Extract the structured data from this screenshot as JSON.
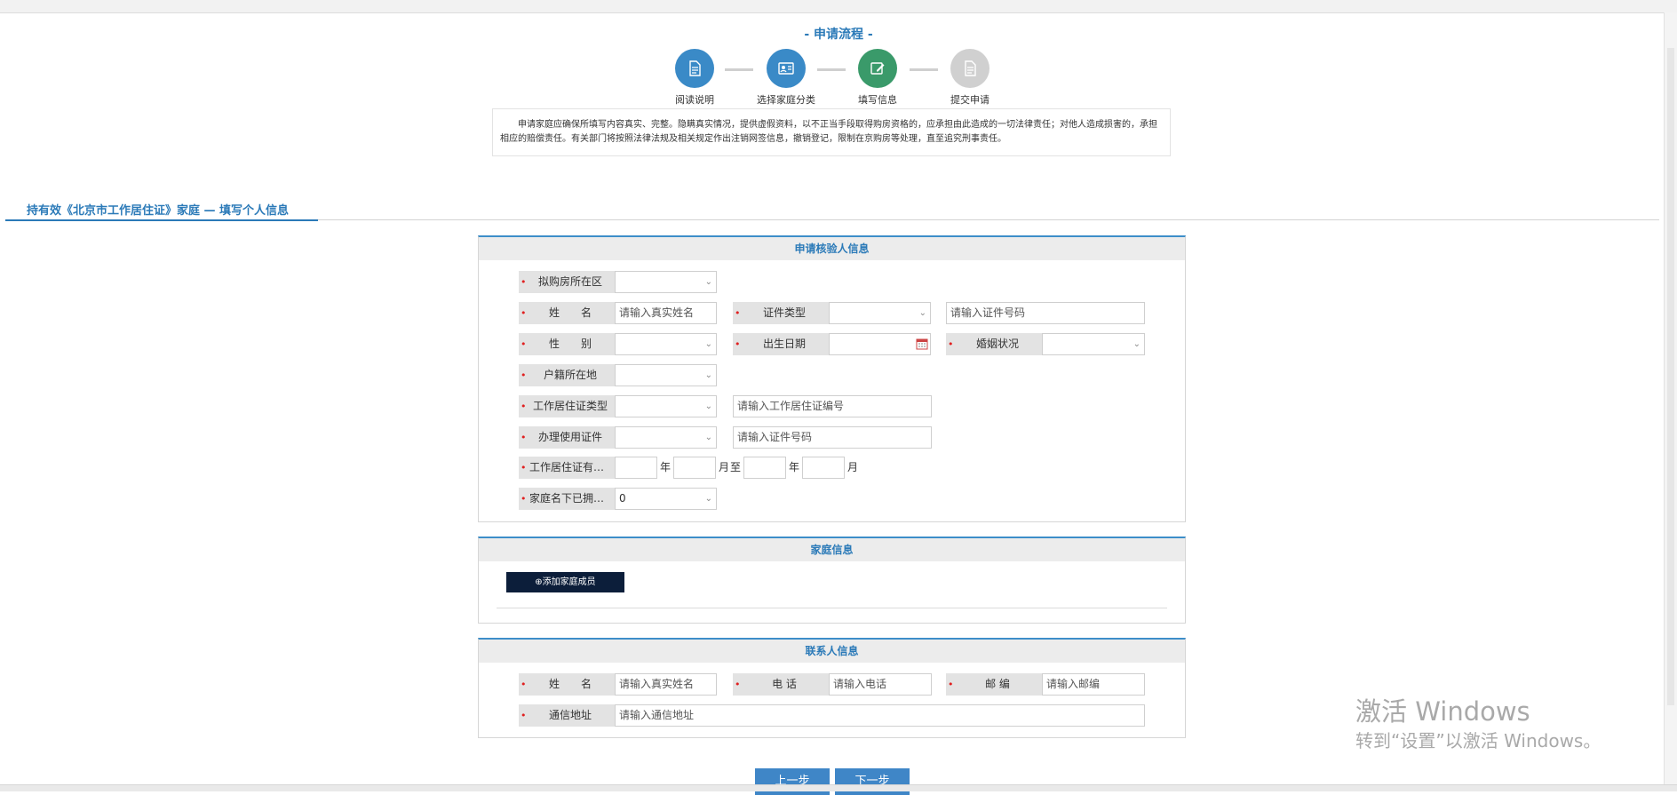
{
  "flow": {
    "title": "- 申请流程 -",
    "steps": [
      {
        "label": "阅读说明",
        "icon": "document-icon",
        "color": "#3a8ac7"
      },
      {
        "label": "选择家庭分类",
        "icon": "id-card-icon",
        "color": "#3a8ac7"
      },
      {
        "label": "填写信息",
        "icon": "edit-icon",
        "color": "#3a9a6a"
      },
      {
        "label": "提交申请",
        "icon": "document-icon",
        "color": "#d0d0d0"
      }
    ],
    "notice": "申请家庭应确保所填写内容真实、完整。隐瞒真实情况，提供虚假资料，以不正当手段取得购房资格的，应承担由此造成的一切法律责任；对他人造成损害的，承担相应的赔偿责任。有关部门将按照法律法规及相关规定作出注销网签信息，撤销登记，限制在京购房等处理，直至追究刑事责任。"
  },
  "page_title": "持有效《北京市工作居住证》家庭 — 填写个人信息",
  "applicant": {
    "header": "申请核验人信息",
    "district_label": "拟购房所在区",
    "name_label": "姓　　名",
    "name_placeholder": "请输入真实姓名",
    "id_type_label": "证件类型",
    "id_number_placeholder": "请输入证件号码",
    "gender_label": "性　　别",
    "birth_label": "出生日期",
    "marital_label": "婚姻状况",
    "hukou_label": "户籍所在地",
    "permit_type_label": "工作居住证类型",
    "permit_number_placeholder": "请输入工作居住证编号",
    "used_id_label": "办理使用证件",
    "used_id_placeholder": "请输入证件号码",
    "permit_validity_label": "工作居住证有效...",
    "unit_year": "年",
    "unit_month": "月",
    "unit_to": "至",
    "houses_label": "家庭名下已拥有...",
    "houses_value": "0"
  },
  "family": {
    "header": "家庭信息",
    "add_button": "⊕添加家庭成员"
  },
  "contact": {
    "header": "联系人信息",
    "name_label": "姓　　名",
    "name_placeholder": "请输入真实姓名",
    "phone_label": "电  话",
    "phone_placeholder": "请输入电话",
    "zip_label": "邮  编",
    "zip_placeholder": "请输入邮编",
    "address_label": "通信地址",
    "address_placeholder": "请输入通信地址"
  },
  "nav": {
    "prev": "上一步",
    "next": "下一步"
  },
  "watermark": {
    "line1": "激活 Windows",
    "line2": "转到“设置”以激活 Windows。"
  }
}
